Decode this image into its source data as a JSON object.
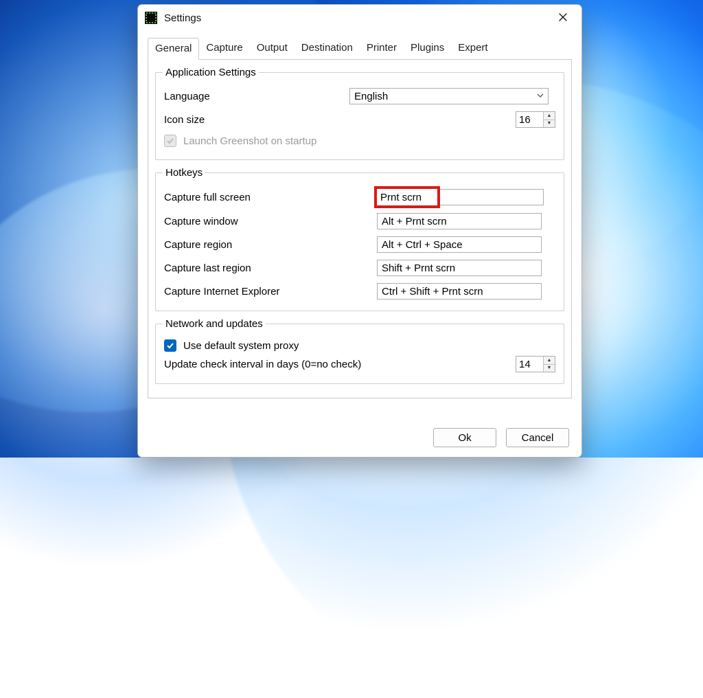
{
  "window": {
    "title": "Settings"
  },
  "tabs": {
    "general": "General",
    "capture": "Capture",
    "output": "Output",
    "destination": "Destination",
    "printer": "Printer",
    "plugins": "Plugins",
    "expert": "Expert",
    "active": "general"
  },
  "group_app": {
    "legend": "Application Settings",
    "language_label": "Language",
    "language_value": "English",
    "iconsize_label": "Icon size",
    "iconsize_value": "16",
    "launch_label": "Launch Greenshot on startup",
    "launch_checked": false,
    "launch_disabled": true
  },
  "group_hotkeys": {
    "legend": "Hotkeys",
    "rows": [
      {
        "label": "Capture full screen",
        "value": "Prnt scrn",
        "highlight": true
      },
      {
        "label": "Capture window",
        "value": "Alt + Prnt scrn",
        "highlight": false
      },
      {
        "label": "Capture region",
        "value": "Alt + Ctrl + Space",
        "highlight": false
      },
      {
        "label": "Capture last region",
        "value": "Shift + Prnt scrn",
        "highlight": false
      },
      {
        "label": "Capture Internet Explorer",
        "value": "Ctrl + Shift + Prnt scrn",
        "highlight": false
      }
    ]
  },
  "group_net": {
    "legend": "Network and updates",
    "proxy_label": "Use default system proxy",
    "proxy_checked": true,
    "update_label": "Update check interval in days (0=no check)",
    "update_value": "14"
  },
  "footer": {
    "ok": "Ok",
    "cancel": "Cancel"
  }
}
